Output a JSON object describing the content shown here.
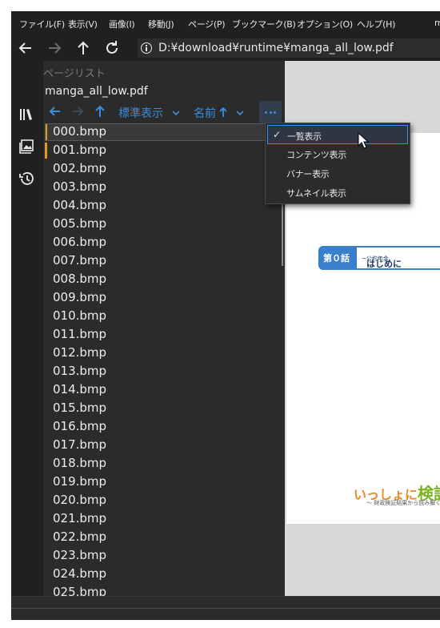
{
  "menu": [
    "ファイル(F)",
    "表示(V)",
    "画像(I)",
    "移動(J)",
    "ページ(P)",
    "ブックマーク(B)",
    "オプション(O)",
    "ヘルプ(H)",
    "m"
  ],
  "address": {
    "path": "D:¥download¥runtime¥manga_all_low.pdf"
  },
  "panel": {
    "title": "ページリスト",
    "file": "manga_all_low.pdf",
    "view_mode": "標準表示",
    "sort": "名前",
    "more_label": "..."
  },
  "files": [
    {
      "name": "000.bmp",
      "marked": true,
      "selected": true
    },
    {
      "name": "001.bmp",
      "marked": true
    },
    {
      "name": "002.bmp"
    },
    {
      "name": "003.bmp"
    },
    {
      "name": "004.bmp"
    },
    {
      "name": "005.bmp"
    },
    {
      "name": "006.bmp"
    },
    {
      "name": "007.bmp"
    },
    {
      "name": "008.bmp"
    },
    {
      "name": "009.bmp"
    },
    {
      "name": "010.bmp"
    },
    {
      "name": "011.bmp"
    },
    {
      "name": "012.bmp"
    },
    {
      "name": "013.bmp"
    },
    {
      "name": "014.bmp"
    },
    {
      "name": "015.bmp"
    },
    {
      "name": "016.bmp"
    },
    {
      "name": "017.bmp"
    },
    {
      "name": "018.bmp"
    },
    {
      "name": "019.bmp"
    },
    {
      "name": "020.bmp"
    },
    {
      "name": "021.bmp"
    },
    {
      "name": "022.bmp"
    },
    {
      "name": "023.bmp"
    },
    {
      "name": "024.bmp"
    },
    {
      "name": "025.bmp"
    }
  ],
  "context_menu": {
    "items": [
      {
        "label": "一覧表示",
        "checked": true
      },
      {
        "label": "コンテンツ表示"
      },
      {
        "label": "バナー表示"
      },
      {
        "label": "サムネイル表示"
      }
    ]
  },
  "viewer": {
    "chapter_badge": "第０話",
    "chapter_title": "はじめに",
    "chapter_subtitle": "~公約年金、",
    "logo_a": "いっしょに",
    "logo_b": "検証",
    "logo_sub": "〜 財政検証結果から読み解く"
  },
  "colors": {
    "accent": "#3b8de0",
    "mark": "#e09a1a",
    "chapter_blue": "#3a7fcb"
  }
}
